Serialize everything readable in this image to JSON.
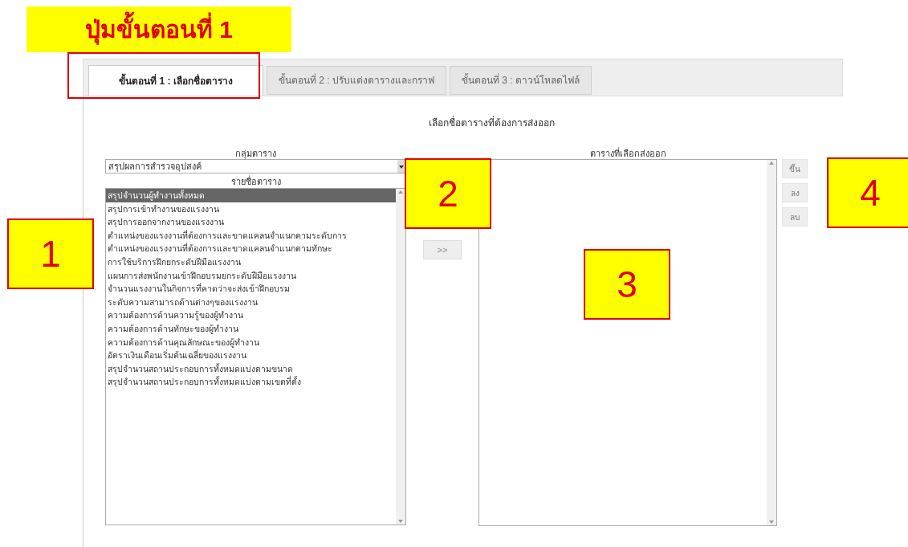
{
  "annotation_title": "ปุ่มขั้นตอนที่ **1**",
  "tabs": [
    {
      "label": "ขั้นตอนที่ 1 : เลือกชื่อตาราง",
      "selected": true
    },
    {
      "label": "ขั้นตอนที่ 2 : ปรับแต่งตารางและกราฟ",
      "selected": false
    },
    {
      "label": "ขั้นตอนที่ 3 : ดาวน์โหลดไฟล์",
      "selected": false
    }
  ],
  "heading": "เลือกชื่อตารางที่ต้องการส่งออก",
  "table_group": {
    "label": "กลุ่มตาราง",
    "value": "สรุปผลการสำรวจอุปสงค์"
  },
  "table_list": {
    "label": "รายชื่อตาราง",
    "items": [
      {
        "label": "สรุปจำนวนผู้ทำงานทั้งหมด",
        "selected": true
      },
      {
        "label": "สรุปการเข้าทำงานของแรงงาน",
        "selected": false
      },
      {
        "label": "สรุปการออกจากงานของแรงงาน",
        "selected": false
      },
      {
        "label": "ตำแหน่งของแรงงานที่ต้องการและขาดแคลนจำแนกตามระดับการ",
        "selected": false
      },
      {
        "label": "ตำแหน่งของแรงงานที่ต้องการและขาดแคลนจำแนกตามทักษะ",
        "selected": false
      },
      {
        "label": "การใช้บริการฝึกยกระดับฝีมือแรงงาน",
        "selected": false
      },
      {
        "label": "แผนการส่งพนักงานเข้าฝึกอบรมยกระดับฝีมือแรงงาน",
        "selected": false
      },
      {
        "label": "จำนวนแรงงานในกิจการที่คาดว่าจะส่งเข้าฝึกอบรม",
        "selected": false
      },
      {
        "label": "ระดับความสามารถด้านต่างๆของแรงงาน",
        "selected": false
      },
      {
        "label": "ความต้องการด้านความรู้ของผู้ทำงาน",
        "selected": false
      },
      {
        "label": "ความต้องการด้านทักษะของผู้ทำงาน",
        "selected": false
      },
      {
        "label": "ความต้องการด้านคุณลักษณะของผู้ทำงาน",
        "selected": false
      },
      {
        "label": "อัตราเงินเดือนเริ่มต้นเฉลี่ยของแรงงาน",
        "selected": false
      },
      {
        "label": "สรุปจำนวนสถานประกอบการทั้งหมดแบ่งตามขนาด",
        "selected": false
      },
      {
        "label": "สรุปจำนวนสถานประกอบการทั้งหมดแบ่งตามเขตที่ตั้ง",
        "selected": false
      }
    ]
  },
  "transfer_button": ">>",
  "selected_tables": {
    "label": "ตารางที่เลือกส่งออก"
  },
  "order_buttons": [
    "ขึ้น",
    "ลง",
    "ลบ"
  ],
  "callouts": [
    "1",
    "2",
    "3",
    "4"
  ]
}
